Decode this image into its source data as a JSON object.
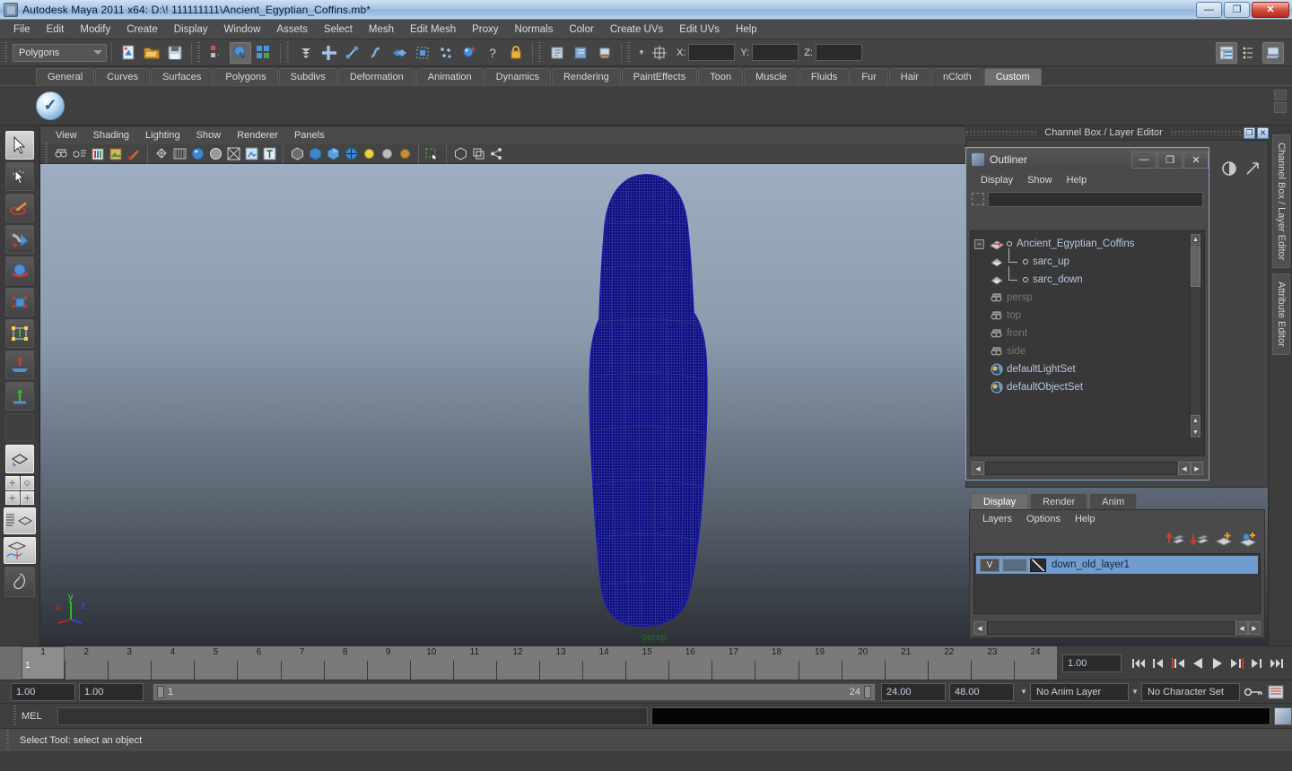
{
  "window": {
    "title": "Autodesk Maya 2011 x64: D:\\! 111111111\\Ancient_Egyptian_Coffins.mb*",
    "app_icon": "maya-icon",
    "minimize": "—",
    "maximize": "❐",
    "close": "✕"
  },
  "menubar": {
    "items": [
      "File",
      "Edit",
      "Modify",
      "Create",
      "Display",
      "Window",
      "Assets",
      "Select",
      "Mesh",
      "Edit Mesh",
      "Proxy",
      "Normals",
      "Color",
      "Create UVs",
      "Edit UVs",
      "Help"
    ]
  },
  "statusbar": {
    "menuset": "Polygons",
    "coord_labels": [
      "X:",
      "Y:",
      "Z:"
    ],
    "coord_values": [
      "",
      "",
      ""
    ]
  },
  "shelf": {
    "tabs": [
      "General",
      "Curves",
      "Surfaces",
      "Polygons",
      "Subdivs",
      "Deformation",
      "Animation",
      "Dynamics",
      "Rendering",
      "PaintEffects",
      "Toon",
      "Muscle",
      "Fluids",
      "Fur",
      "Hair",
      "nCloth",
      "Custom"
    ],
    "active_tab": "Custom",
    "item_glyph": "✓"
  },
  "viewport": {
    "menus": [
      "View",
      "Shading",
      "Lighting",
      "Show",
      "Renderer",
      "Panels"
    ],
    "camera_label": "persp",
    "camera_label_color": "#1f6b2a",
    "axis": {
      "x": "x",
      "y": "y",
      "z": "z",
      "x_color": "#e02020",
      "y_color": "#20e020",
      "z_color": "#3050ff"
    },
    "wireframe_color": "#1a1a9c",
    "background_top": "#9daec1",
    "background_bottom": "#2d3137"
  },
  "channelbox": {
    "title": "Channel Box / Layer Editor",
    "restore": "❐",
    "close": "✕"
  },
  "right_tabs": [
    "Channel Box / Layer Editor",
    "Attribute Editor"
  ],
  "outliner": {
    "title": "Outliner",
    "icon": "outliner-icon",
    "minimize": "—",
    "maximize": "❐",
    "close": "✕",
    "menus": [
      "Display",
      "Show",
      "Help"
    ],
    "search_value": "",
    "items": [
      {
        "label": "Ancient_Egyptian_Coffins",
        "icon": "transform-icon",
        "dim": false,
        "expand": "−",
        "child": false
      },
      {
        "label": "sarc_up",
        "icon": "mesh-icon",
        "dim": false,
        "expand": "",
        "child": true
      },
      {
        "label": "sarc_down",
        "icon": "mesh-icon",
        "dim": false,
        "expand": "",
        "child": true
      },
      {
        "label": "persp",
        "icon": "camera-icon",
        "dim": true,
        "expand": "",
        "child": false
      },
      {
        "label": "top",
        "icon": "camera-icon",
        "dim": true,
        "expand": "",
        "child": false
      },
      {
        "label": "front",
        "icon": "camera-icon",
        "dim": true,
        "expand": "",
        "child": false
      },
      {
        "label": "side",
        "icon": "camera-icon",
        "dim": true,
        "expand": "",
        "child": false
      },
      {
        "label": "defaultLightSet",
        "icon": "set-icon",
        "dim": false,
        "expand": "",
        "child": false
      },
      {
        "label": "defaultObjectSet",
        "icon": "set-icon",
        "dim": false,
        "expand": "",
        "child": false
      }
    ]
  },
  "layer_editor": {
    "tabs": [
      "Display",
      "Render",
      "Anim"
    ],
    "active_tab": "Display",
    "menus": [
      "Layers",
      "Options",
      "Help"
    ],
    "toolbar_icons": [
      "move-layer-up-icon",
      "move-layer-down-icon",
      "new-layer-icon",
      "new-layer-from-selected-icon"
    ],
    "layers": [
      {
        "visibility": "V",
        "playback": "",
        "name": "down_old_layer1",
        "selected": true
      }
    ]
  },
  "timeline": {
    "frames": [
      1,
      2,
      3,
      4,
      5,
      6,
      7,
      8,
      9,
      10,
      11,
      12,
      13,
      14,
      15,
      16,
      17,
      18,
      19,
      20,
      21,
      22,
      23,
      24
    ],
    "current_frame": "1",
    "current_frame_field": "1.00",
    "playback_buttons": [
      "go-to-start",
      "step-back-key",
      "step-back-frame",
      "play-backwards",
      "play-forwards",
      "step-forward-frame",
      "step-forward-key",
      "go-to-end"
    ]
  },
  "range": {
    "anim_start": "1.00",
    "range_start": "1.00",
    "slider_left": "1",
    "slider_right": "24",
    "range_end": "24.00",
    "anim_end": "48.00",
    "anim_layer": "No Anim Layer",
    "character_set": "No Character Set"
  },
  "command_line": {
    "label": "MEL",
    "value": "",
    "placeholder": ""
  },
  "help_line": {
    "text": "Select Tool: select an object"
  },
  "toolbox": {
    "tools": [
      "select-tool",
      "lasso-select-tool",
      "paint-select-tool",
      "move-tool",
      "rotate-tool",
      "scale-tool",
      "universal-manipulator-tool",
      "soft-modification-tool",
      "last-tool-used"
    ],
    "layouts": [
      "single-perspective-layout",
      "four-view-layout",
      "outliner-persp-layout",
      "hypergraph-persp-layout",
      "persp-graph-editor-layout"
    ]
  }
}
